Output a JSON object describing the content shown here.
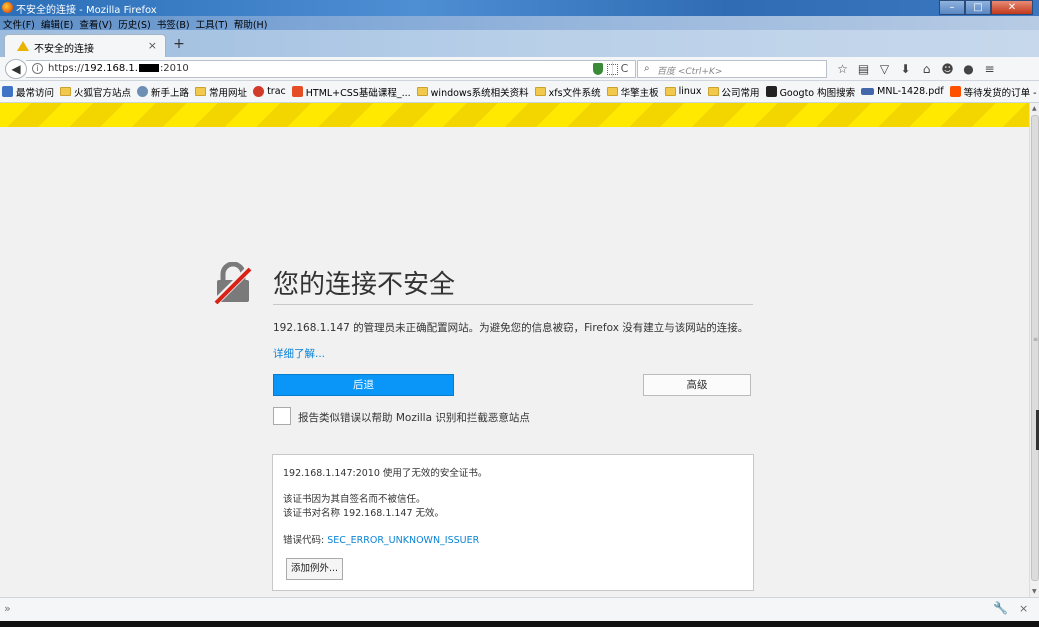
{
  "window": {
    "title": "不安全的连接 - Mozilla Firefox",
    "minimize": "–",
    "maximize": "□",
    "close": "✕"
  },
  "menu": [
    "文件(F)",
    "编辑(E)",
    "查看(V)",
    "历史(S)",
    "书签(B)",
    "工具(T)",
    "帮助(H)"
  ],
  "tab": {
    "title": "不安全的连接",
    "close": "×",
    "new": "+"
  },
  "nav": {
    "url_prefix": "https://",
    "url_host": "192.168.1.",
    "url_port": ":2010",
    "search_placeholder": "百度 <Ctrl+K>"
  },
  "bookmarks": [
    {
      "label": "最常访问",
      "icon": "bookmark-star-icon",
      "color": "#3f73c5"
    },
    {
      "label": "火狐官方站点",
      "icon": "folder-icon"
    },
    {
      "label": "新手上路",
      "icon": "globe-icon",
      "color": "#6b8fb5"
    },
    {
      "label": "常用网址",
      "icon": "folder-icon"
    },
    {
      "label": "trac",
      "icon": "trac-icon",
      "color": "#d23a2a"
    },
    {
      "label": "HTML+CSS基础课程_...",
      "icon": "html-icon",
      "color": "#e44d26"
    },
    {
      "label": "windows系统相关资料",
      "icon": "folder-icon"
    },
    {
      "label": "xfs文件系统",
      "icon": "folder-icon"
    },
    {
      "label": "华擎主板",
      "icon": "folder-icon"
    },
    {
      "label": "linux",
      "icon": "folder-icon"
    },
    {
      "label": "公司常用",
      "icon": "folder-icon"
    },
    {
      "label": "Googto 构图搜索",
      "icon": "googto-icon",
      "color": "#222222"
    },
    {
      "label": "MNL-1428.pdf",
      "icon": "pdf-icon",
      "color": "#4466aa"
    },
    {
      "label": "等待发货的订单 - 淘...",
      "icon": "taobao-icon",
      "color": "#ff5000"
    }
  ],
  "error": {
    "title": "您的连接不安全",
    "description": "192.168.1.147 的管理员未正确配置网站。为避免您的信息被窃，Firefox 没有建立与该网站的连接。",
    "learn_more": "详细了解...",
    "back_button": "后退",
    "advanced_button": "高级",
    "report_label": "报告类似错误以帮助 Mozilla 识别和拦截恶意站点",
    "details": {
      "line1": "192.168.1.147:2010 使用了无效的安全证书。",
      "line2": "该证书因为其自签名而不被信任。",
      "line3": "该证书对名称 192.168.1.147 无效。",
      "code_label": "错误代码: ",
      "code": "SEC_ERROR_UNKNOWN_ISSUER",
      "add_exception": "添加例外..."
    }
  },
  "addonbar": {
    "chevron": "»",
    "close": "×"
  },
  "colors": {
    "warning_stripe": "#ffe900",
    "primary_button": "#0996f8",
    "link": "#0a84d6"
  }
}
